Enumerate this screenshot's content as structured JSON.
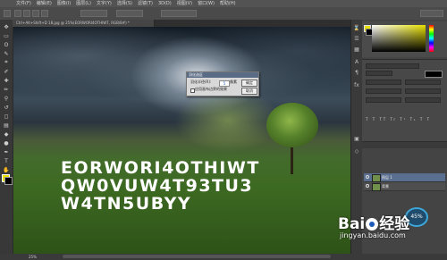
{
  "menubar": {
    "items": [
      "Ps",
      "文件(F)",
      "编辑(E)",
      "图像(I)",
      "图层(L)",
      "文字(Y)",
      "选择(S)",
      "滤镜(T)",
      "3D(D)",
      "视图(V)",
      "窗口(W)",
      "帮助(H)"
    ]
  },
  "document": {
    "tab_label": "Ctrl+Alt+Shift+D 18.jpg @ 25%(EORWORI4OTHIWT, RGB/8#) *"
  },
  "canvas": {
    "text_lines": "EORWORI4OTHIWT\nQW0VUW4T93TU3\nW4TN5UBYY"
  },
  "dialog": {
    "title": "羽化选区",
    "radius_label": "羽化半径(R):",
    "radius_value": "5",
    "unit": "像素",
    "checkbox_label": "应用画布边界的效果",
    "ok_label": "确定",
    "cancel_label": "取消"
  },
  "layers": [
    {
      "name": "图层 1"
    },
    {
      "name": "背景"
    }
  ],
  "status": {
    "zoom": "25%",
    "badge": "45%"
  },
  "watermark": {
    "brand": "Bai",
    "brand2": "经验",
    "url": "jingyan.baidu.com"
  },
  "colors": {
    "foreground": "#e6e000",
    "background": "#000000",
    "accent": "#3ea7d9"
  }
}
